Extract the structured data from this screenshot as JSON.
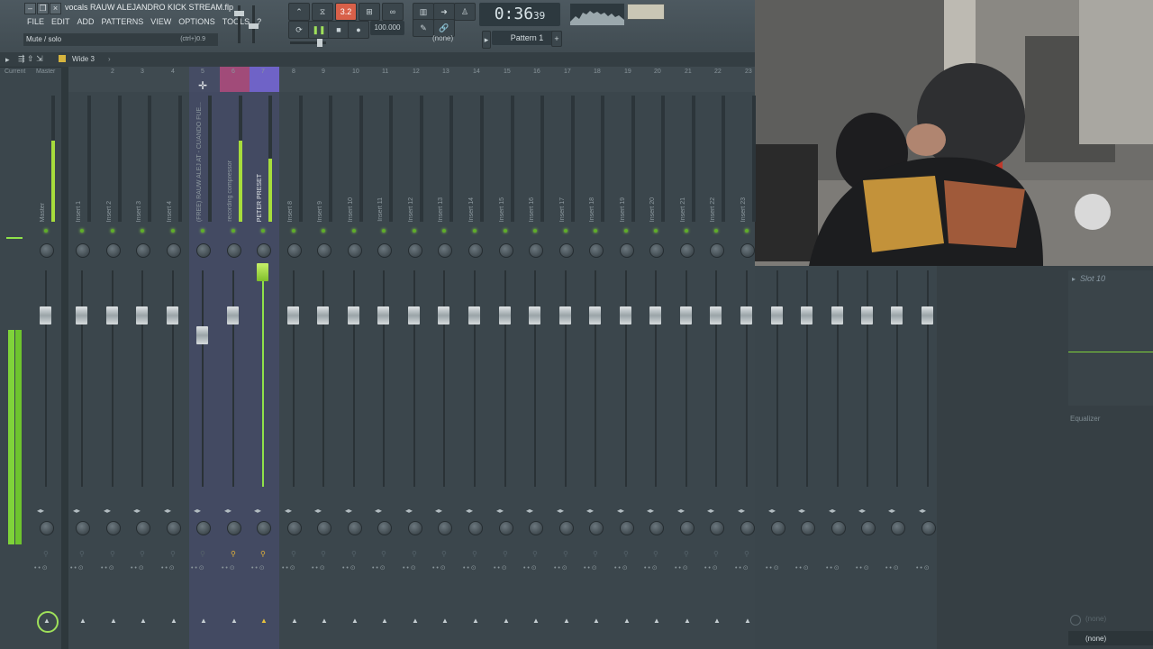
{
  "window": {
    "title": "vocals RAUW ALEJANDRO KICK STREAM.flp"
  },
  "menu": [
    "FILE",
    "EDIT",
    "ADD",
    "PATTERNS",
    "VIEW",
    "OPTIONS",
    "TOOLS",
    "?"
  ],
  "hint": {
    "text": "Mute / solo",
    "shortcut": "(ctrl+)0.9"
  },
  "transport": {
    "time": "0:36",
    "time_small": "39",
    "tempo": "100.000",
    "pattern": "Pattern 1",
    "snap": "(none)",
    "mode_label": "3.2"
  },
  "mixer": {
    "preset": "Wide 3",
    "ruler_labels": [
      "Current",
      "Master",
      "1",
      "2",
      "3",
      "4",
      "5",
      "6",
      "7",
      "8",
      "9",
      "10",
      "11",
      "12",
      "13",
      "14",
      "15",
      "16",
      "17",
      "18",
      "19",
      "20",
      "21",
      "22",
      "23"
    ],
    "tracks": [
      "Master",
      "Insert 1",
      "Insert 2",
      "Insert 3",
      "Insert 4",
      "(FREE) RAUW ALEJ AT - CUANDO FUE...",
      "recording compressor",
      "PETER PRESET",
      "Insert 8",
      "Insert 9",
      "Insert 10",
      "Insert 11",
      "Insert 12",
      "Insert 13",
      "Insert 14",
      "Insert 15",
      "Insert 16",
      "Insert 17",
      "Insert 18",
      "Insert 19",
      "Insert 20",
      "Insert 21",
      "Insert 22",
      "Insert 23"
    ]
  },
  "slots": {
    "slot_label": "Slot 10",
    "equalizer_label": "Equalizer",
    "out_none": "(none)",
    "in_none": "(none)"
  },
  "colors": {
    "accent_green": "#8fe24a",
    "selected_track": "#6f63c7",
    "track6_tab": "#b84b7e"
  }
}
